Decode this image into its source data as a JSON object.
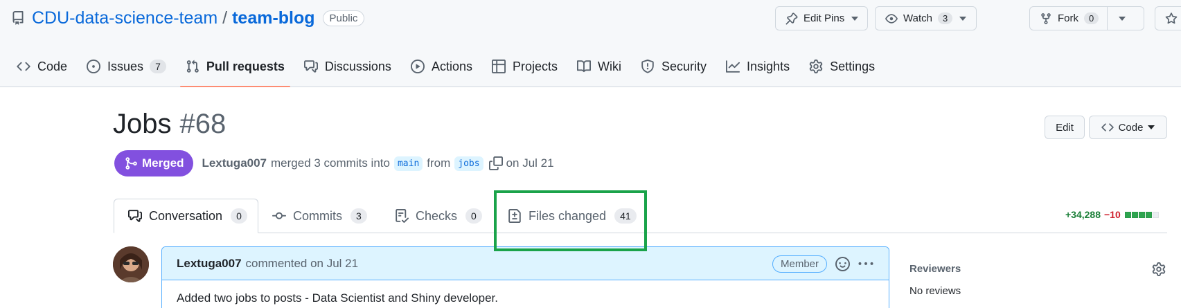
{
  "repo": {
    "owner": "CDU-data-science-team",
    "separator": "/",
    "name": "team-blog",
    "visibility": "Public"
  },
  "header_buttons": {
    "edit_pins": "Edit Pins",
    "watch": "Watch",
    "watch_count": "3",
    "fork": "Fork",
    "fork_count": "0"
  },
  "nav": {
    "code": "Code",
    "issues": "Issues",
    "issues_count": "7",
    "pull_requests": "Pull requests",
    "discussions": "Discussions",
    "actions": "Actions",
    "projects": "Projects",
    "wiki": "Wiki",
    "security": "Security",
    "insights": "Insights",
    "settings": "Settings",
    "selected": "Pull requests"
  },
  "pr": {
    "title": "Jobs",
    "number": "#68",
    "edit": "Edit",
    "code": "Code",
    "state": "Merged",
    "author": "Lextuga007",
    "merged_text": "merged 3 commits into",
    "base_branch": "main",
    "from_text": "from",
    "head_branch": "jobs",
    "date_text": "on Jul 21"
  },
  "tabs": {
    "conversation": "Conversation",
    "conversation_count": "0",
    "commits": "Commits",
    "commits_count": "3",
    "checks": "Checks",
    "checks_count": "0",
    "files_changed": "Files changed",
    "files_changed_count": "41",
    "active": "Conversation"
  },
  "diffstat": {
    "additions": "+34,288",
    "deletions": "−10",
    "colors": [
      "#2da44e",
      "#2da44e",
      "#2da44e",
      "#2da44e",
      "#eaeef2"
    ]
  },
  "comment": {
    "author": "Lextuga007",
    "meta": "commented on Jul 21",
    "role": "Member",
    "body": "Added two jobs to posts - Data Scientist and Shiny developer."
  },
  "sidebar": {
    "reviewers_label": "Reviewers",
    "reviewers_value": "No reviews"
  },
  "colors": {
    "merged": "#8250df",
    "link": "#0969da",
    "highlight": "#1aa34a",
    "active_nav_underline": "#fd8c73"
  }
}
